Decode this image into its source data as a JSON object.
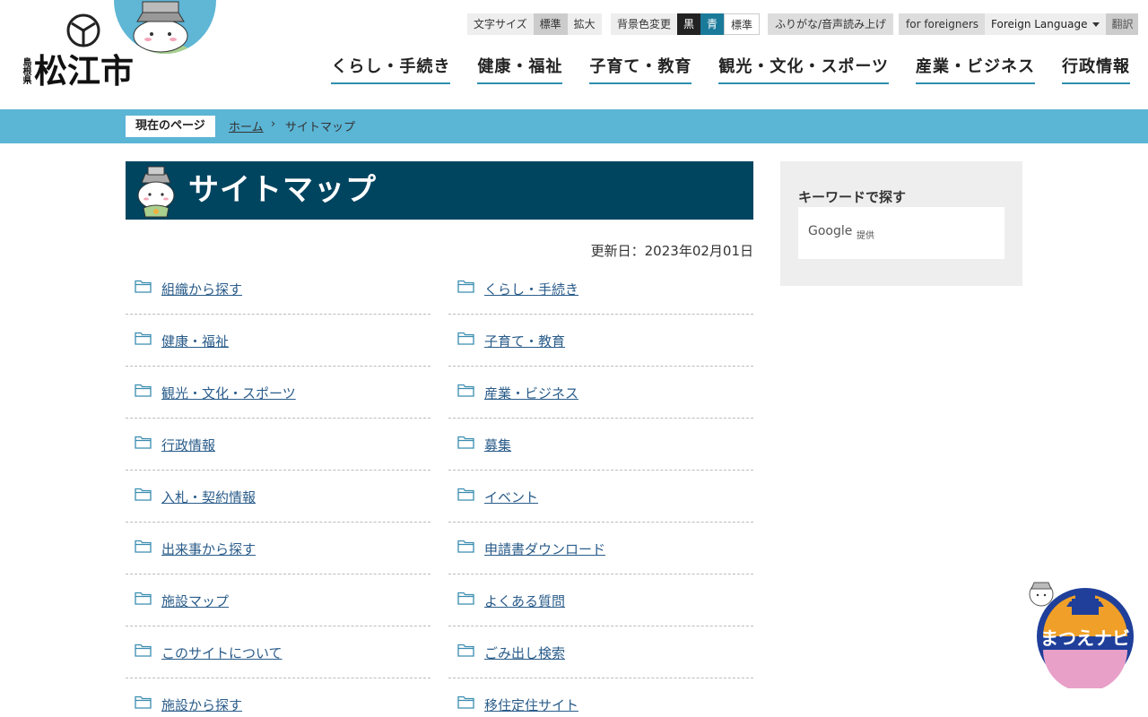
{
  "header": {
    "logo_pref": "島根県",
    "logo_city": "松江市",
    "utility": {
      "font_size_label": "文字サイズ",
      "font_standard": "標準",
      "font_large": "拡大",
      "bg_label": "背景色変更",
      "bg_black": "黒",
      "bg_blue": "青",
      "bg_standard": "標準",
      "furigana": "ふりがな/音声読み上げ",
      "foreigners": "for foreigners",
      "foreign_language": "Foreign Language",
      "translate": "翻訳"
    },
    "nav": [
      "くらし・手続き",
      "健康・福祉",
      "子育て・教育",
      "観光・文化・スポーツ",
      "産業・ビジネス",
      "行政情報"
    ]
  },
  "breadcrumb": {
    "label": "現在のページ",
    "home": "ホーム",
    "separator": "›",
    "current": "サイトマップ"
  },
  "page": {
    "title": "サイトマップ",
    "updated": "更新日：2023年02月01日"
  },
  "sitemap": {
    "left": [
      "組織から探す",
      "健康・福祉",
      "観光・文化・スポーツ",
      "行政情報",
      "入札・契約情報",
      "出来事から探す",
      "施設マップ",
      "このサイトについて",
      "施設から探す"
    ],
    "right": [
      "くらし・手続き",
      "子育て・教育",
      "産業・ビジネス",
      "募集",
      "イベント",
      "申請書ダウンロード",
      "よくある質問",
      "ごみ出し検索",
      "移住定住サイト"
    ]
  },
  "sidebar": {
    "heading": "キーワードで探す",
    "google": "Google",
    "google_sub": "提供"
  },
  "navi": {
    "label": "まつえナビ"
  },
  "colors": {
    "accent": "#5bb5d5",
    "title_bg": "#004560",
    "link": "#2a5c8a",
    "nav_underline": "#2f8fb0"
  },
  "icons": [
    "city-emblem-icon",
    "mascot-icon",
    "folder-icon",
    "dropdown-caret-icon"
  ]
}
